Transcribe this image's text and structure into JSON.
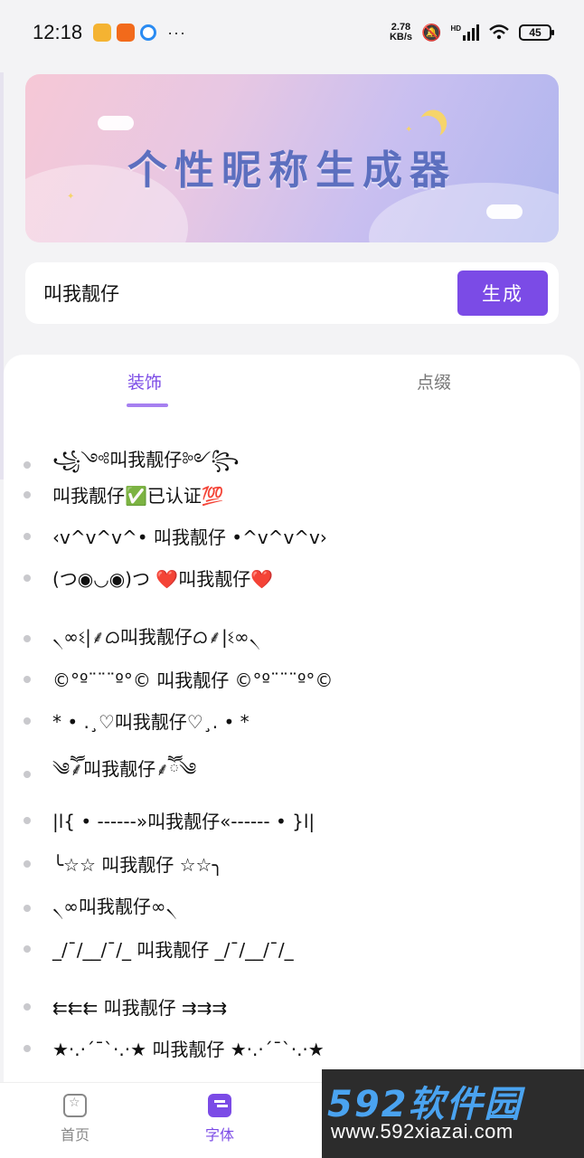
{
  "status_bar": {
    "time": "12:18",
    "more": "···",
    "net_speed_value": "2.78",
    "net_speed_unit": "KB/s",
    "hd_label": "HD",
    "battery": "45"
  },
  "banner": {
    "title": "个性昵称生成器"
  },
  "search": {
    "value": "叫我靓仔",
    "generate_label": "生成"
  },
  "tabs": [
    {
      "label": "装饰",
      "active": true
    },
    {
      "label": "点缀",
      "active": false
    }
  ],
  "results": [
    "꧁༺叫我靓仔༻꧂",
    "叫我靓仔✅已认证💯",
    "‹v^v^v^• 叫我靓仔 •^v^v^v›",
    "(つ◉◡◉)つ ❤️叫我靓仔❤️",
    "৲∞ଽ|⸙ᜊ叫我靓仔ᜊ⸙|ଽ∞৲",
    "©°º¨¨¨º°© 叫我靓仔 ©°º¨¨¨º°©",
    "* • .¸♡叫我靓仔♡¸. • *",
    "༄ཽ⸙叫我靓仔⸙ཽ༄",
    "|l{ • ------»叫我靓仔«------ • }l|",
    "╰☆☆ 叫我靓仔 ☆☆╮",
    "৲∞叫我靓仔∞৲",
    "_/¯/__/¯/_ 叫我靓仔 _/¯/__/¯/_",
    "⇇⇇⇇ 叫我靓仔 ⇉⇉⇉",
    "★·.·´¯`·.·★ 叫我靓仔 ★·.·´¯`·.·★"
  ],
  "bottom_nav": {
    "home_label": "首页",
    "font_label": "字体"
  },
  "watermark": {
    "logo": "592软件园",
    "url": "www.592xiazai.com"
  },
  "colors": {
    "accent": "#7b4be6",
    "background": "#f3f3f5"
  }
}
